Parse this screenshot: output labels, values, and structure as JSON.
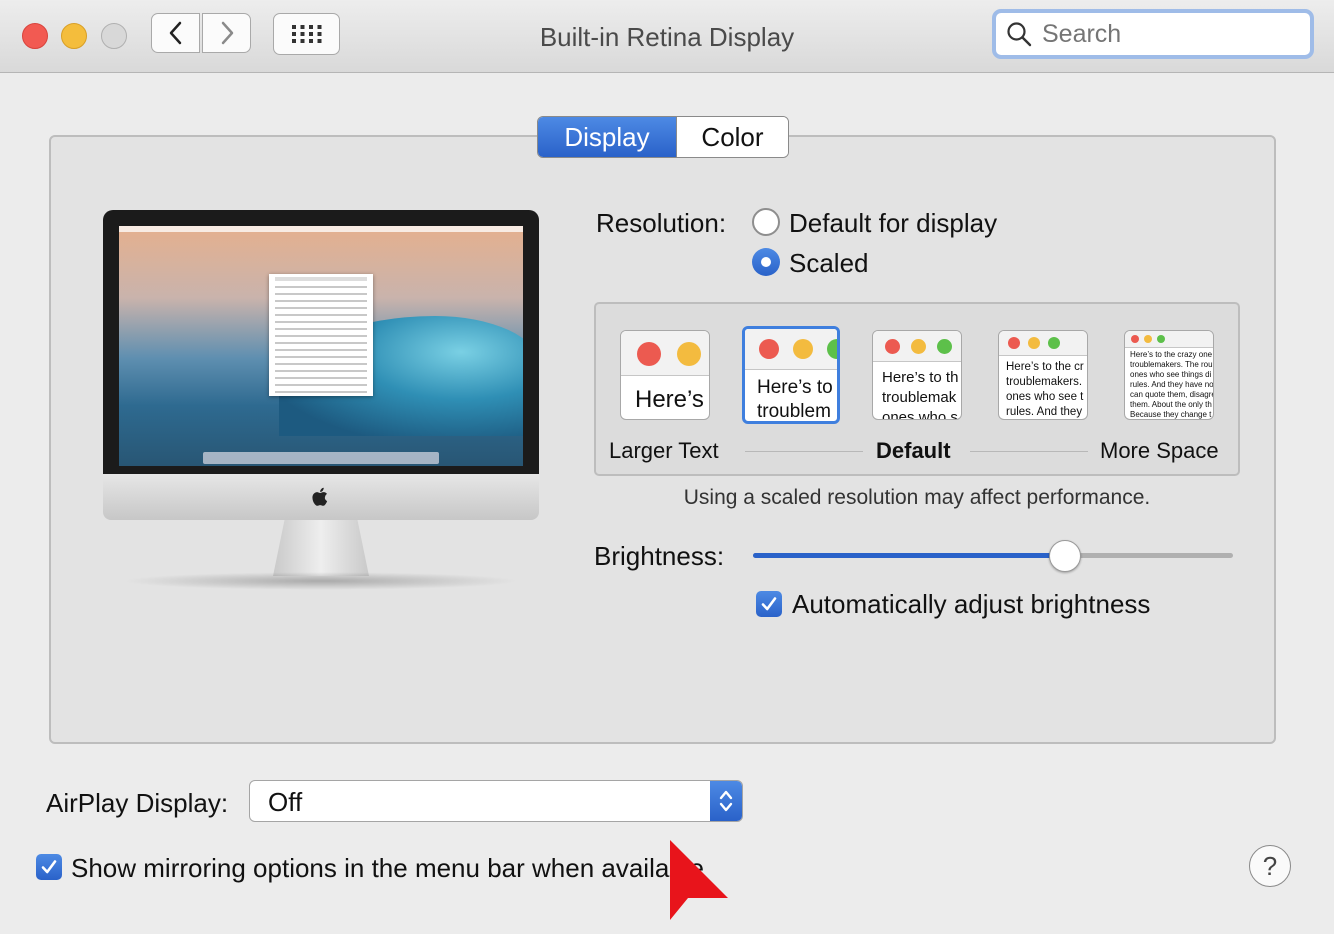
{
  "window": {
    "title": "Built-in Retina Display",
    "search_placeholder": "Search"
  },
  "tabs": [
    {
      "label": "Display",
      "selected": true
    },
    {
      "label": "Color",
      "selected": false
    }
  ],
  "resolution": {
    "label": "Resolution:",
    "options": [
      {
        "label": "Default for display",
        "selected": false
      },
      {
        "label": "Scaled",
        "selected": true
      }
    ]
  },
  "scaled": {
    "thumbs": [
      {
        "text": "Here’s"
      },
      {
        "text1": "Here’s to",
        "text2": "troublem"
      },
      {
        "text1": "Here’s to th",
        "text2": "troublemak",
        "text3": "ones who s"
      },
      {
        "text1": "Here’s to the cr",
        "text2": "troublemakers.",
        "text3": "ones who see t",
        "text4": "rules. And they"
      },
      {
        "lines": [
          "Here’s to the crazy one",
          "troublemakers. The rou",
          "ones who see things di",
          "rules. And they have no",
          "can quote them, disagre",
          "them. About the only th",
          "Because they change t"
        ]
      }
    ],
    "label_left": "Larger Text",
    "label_mid": "Default",
    "label_right": "More Space",
    "note": "Using a scaled resolution may affect performance."
  },
  "brightness": {
    "label": "Brightness:",
    "level": 0.65,
    "auto_label": "Automatically adjust brightness",
    "auto_checked": true
  },
  "airplay": {
    "label": "AirPlay Display:",
    "value": "Off"
  },
  "mirroring": {
    "label": "Show mirroring options in the menu bar when available",
    "checked": true
  },
  "help": {
    "symbol": "?"
  },
  "colors": {
    "accent": "#2a62c9",
    "close": "#f25a52",
    "minimize": "#f4bd3c",
    "cursor": "#e8141b"
  }
}
